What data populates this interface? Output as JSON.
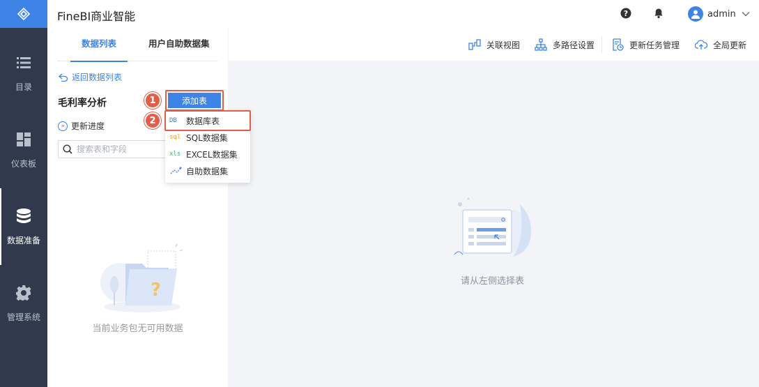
{
  "app": {
    "title": "FineBI商业智能"
  },
  "nav": {
    "items": [
      {
        "label": "目录",
        "icon": "list-icon"
      },
      {
        "label": "仪表板",
        "icon": "dashboard-icon"
      },
      {
        "label": "数据准备",
        "icon": "database-icon"
      },
      {
        "label": "管理系统",
        "icon": "gear-icon"
      }
    ]
  },
  "header": {
    "user_name": "admin"
  },
  "tabs": [
    {
      "label": "数据列表"
    },
    {
      "label": "用户自助数据集"
    }
  ],
  "left": {
    "back_label": "返回数据列表",
    "package_name": "毛利率分析",
    "update_label": "更新进度",
    "search_placeholder": "搜索表和字段",
    "empty_text": "当前业务包无可用数据"
  },
  "add_button": {
    "label": "添加表"
  },
  "steps": [
    "1",
    "2"
  ],
  "dropdown": [
    {
      "tag": "DB",
      "label": "数据库表",
      "color": "#3d84e6"
    },
    {
      "tag": "sql",
      "label": "SQL数据集",
      "color": "#f0a23b"
    },
    {
      "tag": "xls",
      "label": "EXCEL数据集",
      "color": "#3cb371"
    },
    {
      "tag": "",
      "label": "自助数据集",
      "color": "#3d84e6"
    }
  ],
  "toolbar": [
    {
      "label": "关联视图",
      "icon": "relation-view-icon"
    },
    {
      "label": "多路径设置",
      "icon": "path-tree-icon"
    },
    {
      "label": "更新任务管理",
      "icon": "task-manage-icon"
    },
    {
      "label": "全局更新",
      "icon": "cloud-update-icon"
    }
  ],
  "main": {
    "empty_text": "请从左侧选择表"
  },
  "colors": {
    "accent": "#3d84e6",
    "nav_bg": "#303a4c",
    "highlight": "#e15f4a"
  }
}
